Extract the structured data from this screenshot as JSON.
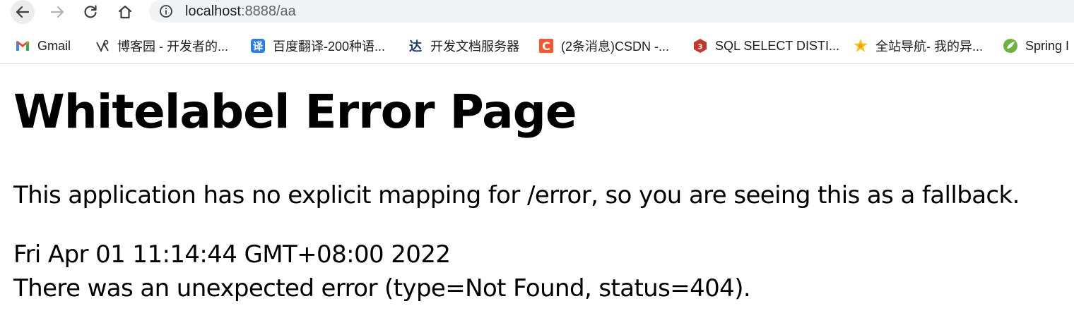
{
  "browser": {
    "url_host": "localhost",
    "url_path": ":8888/aa"
  },
  "bookmarks": [
    {
      "label": "Gmail",
      "icon": "gmail-icon"
    },
    {
      "label": "博客园 - 开发者的...",
      "icon": "cnblogs-icon"
    },
    {
      "label": "百度翻译-200种语...",
      "icon": "baidu-translate-icon"
    },
    {
      "label": "开发文档服务器",
      "icon": "devdocs-icon"
    },
    {
      "label": "(2条消息)CSDN -...",
      "icon": "csdn-icon"
    },
    {
      "label": "SQL SELECT DISTI...",
      "icon": "w3school-icon"
    },
    {
      "label": "全站导航- 我的异...",
      "icon": "nav-icon"
    },
    {
      "label": "Spring I",
      "icon": "spring-icon"
    }
  ],
  "page": {
    "title": "Whitelabel Error Page",
    "message": "This application has no explicit mapping for /error, so you are seeing this as a fallback.",
    "timestamp": "Fri Apr 01 11:14:44 GMT+08:00 2022",
    "error_detail": "There was an unexpected error (type=Not Found, status=404)."
  }
}
